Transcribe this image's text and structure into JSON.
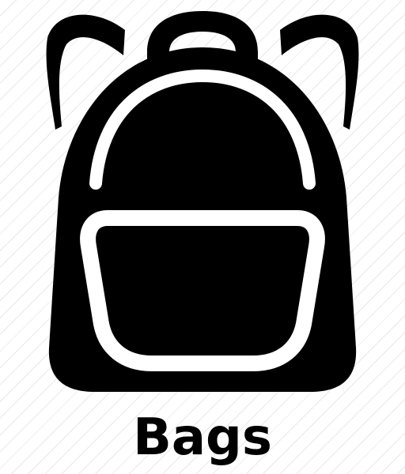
{
  "icon": {
    "name": "backpack-icon",
    "fill_color": "#000000",
    "cutout_color": "#ffffff"
  },
  "caption": {
    "text": "Bags"
  },
  "background": {
    "color": "#ffffff",
    "stripe_color": "#e9e9e9",
    "pattern": "diagonal-stripes"
  }
}
